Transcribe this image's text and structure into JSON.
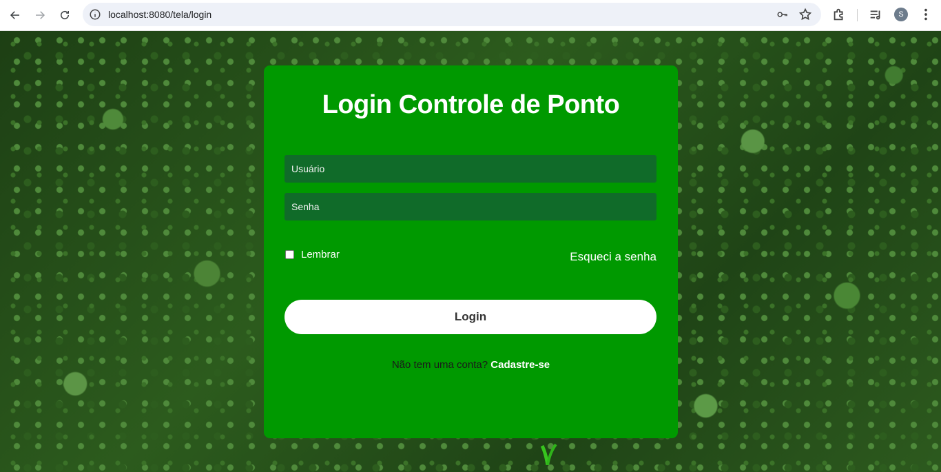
{
  "browser": {
    "url": "localhost:8080/tela/login",
    "avatar_initial": "S"
  },
  "card": {
    "title": "Login Controle de Ponto",
    "username_placeholder": "Usuário",
    "password_placeholder": "Senha",
    "remember_label": "Lembrar",
    "forgot_link": "Esqueci a senha",
    "login_button": "Login",
    "signup_prompt": "Não tem uma conta?",
    "signup_link": "Cadastre-se"
  },
  "colors": {
    "card_bg": "#009900",
    "field_bg": "#106b29",
    "button_bg": "#ffffff"
  }
}
